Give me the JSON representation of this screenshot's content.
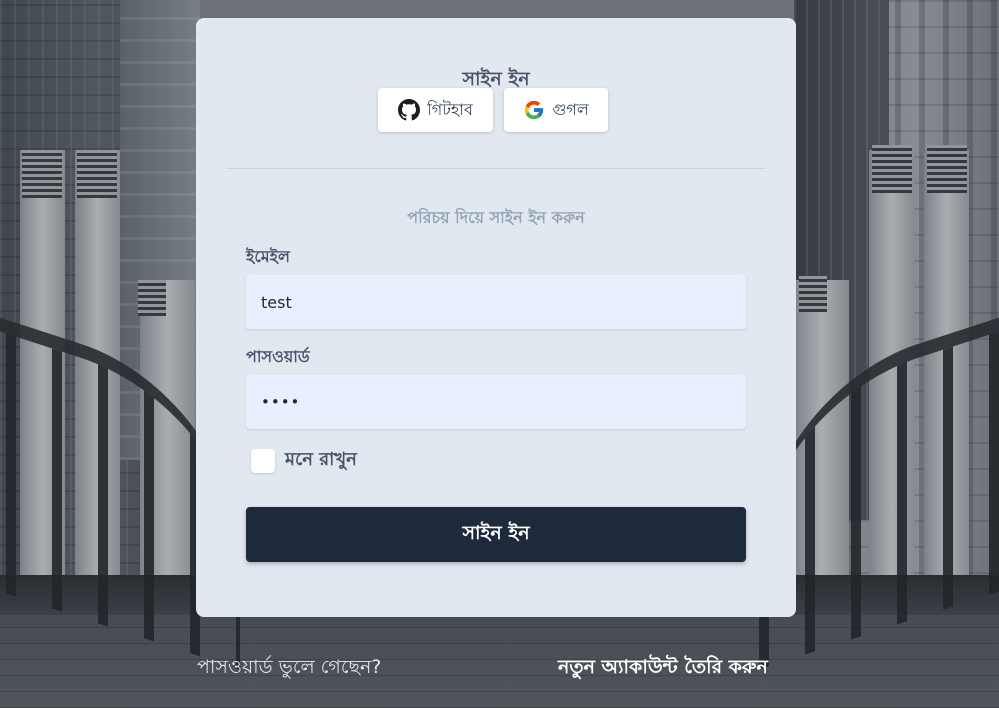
{
  "card": {
    "title": "সাইন ইন",
    "subtitle": "পরিচয় দিয়ে সাইন ইন করুন"
  },
  "social": {
    "github_label": "গিটহাব",
    "google_label": "গুগল"
  },
  "form": {
    "email_label": "ইমেইল",
    "email_value": "test",
    "password_label": "পাসওয়ার্ড",
    "password_value": "••••",
    "remember_label": "মনে রাখুন",
    "remember_checked": false,
    "submit_label": "সাইন ইন"
  },
  "footer": {
    "forgot_password": "পাসওয়ার্ড ভুলে গেছেন?",
    "create_account": "নতুন অ্যাকাউন্ট তৈরি করুন"
  },
  "colors": {
    "card_bg": "#e2e8f0",
    "primary_button": "#1e293b",
    "input_bg": "#e8f0fe",
    "heading": "#475569",
    "muted": "#94a3b8"
  }
}
